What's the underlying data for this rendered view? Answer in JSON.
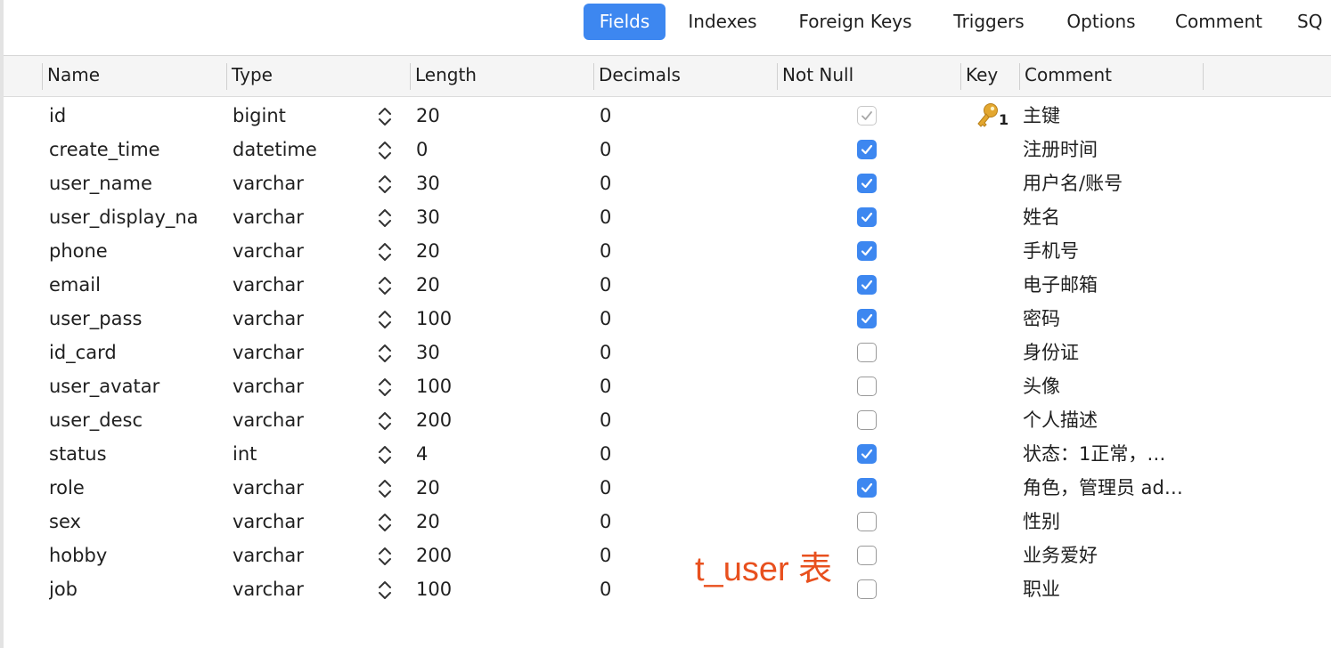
{
  "tabs": [
    {
      "label": "Fields",
      "active": true
    },
    {
      "label": "Indexes",
      "active": false
    },
    {
      "label": "Foreign Keys",
      "active": false
    },
    {
      "label": "Triggers",
      "active": false
    },
    {
      "label": "Options",
      "active": false
    },
    {
      "label": "Comment",
      "active": false
    },
    {
      "label": "SQ",
      "active": false
    }
  ],
  "columns": [
    "Name",
    "Type",
    "Length",
    "Decimals",
    "Not Null",
    "Key",
    "Comment"
  ],
  "rows": [
    {
      "name": "id",
      "type": "bigint",
      "length": "20",
      "decimals": "0",
      "not_null": true,
      "not_null_disabled": true,
      "key": "1",
      "comment": "主键"
    },
    {
      "name": "create_time",
      "type": "datetime",
      "length": "0",
      "decimals": "0",
      "not_null": true,
      "key": "",
      "comment": "注册时间"
    },
    {
      "name": "user_name",
      "type": "varchar",
      "length": "30",
      "decimals": "0",
      "not_null": true,
      "key": "",
      "comment": "用户名/账号"
    },
    {
      "name": "user_display_na",
      "type": "varchar",
      "length": "30",
      "decimals": "0",
      "not_null": true,
      "key": "",
      "comment": "姓名"
    },
    {
      "name": "phone",
      "type": "varchar",
      "length": "20",
      "decimals": "0",
      "not_null": true,
      "key": "",
      "comment": "手机号"
    },
    {
      "name": "email",
      "type": "varchar",
      "length": "20",
      "decimals": "0",
      "not_null": true,
      "key": "",
      "comment": "电子邮箱"
    },
    {
      "name": "user_pass",
      "type": "varchar",
      "length": "100",
      "decimals": "0",
      "not_null": true,
      "key": "",
      "comment": "密码"
    },
    {
      "name": "id_card",
      "type": "varchar",
      "length": "30",
      "decimals": "0",
      "not_null": false,
      "key": "",
      "comment": "身份证"
    },
    {
      "name": "user_avatar",
      "type": "varchar",
      "length": "100",
      "decimals": "0",
      "not_null": false,
      "key": "",
      "comment": "头像"
    },
    {
      "name": "user_desc",
      "type": "varchar",
      "length": "200",
      "decimals": "0",
      "not_null": false,
      "key": "",
      "comment": "个人描述"
    },
    {
      "name": "status",
      "type": "int",
      "length": "4",
      "decimals": "0",
      "not_null": true,
      "key": "",
      "comment": "状态：1正常，…"
    },
    {
      "name": "role",
      "type": "varchar",
      "length": "20",
      "decimals": "0",
      "not_null": true,
      "key": "",
      "comment": "角色，管理员 ad…"
    },
    {
      "name": "sex",
      "type": "varchar",
      "length": "20",
      "decimals": "0",
      "not_null": false,
      "key": "",
      "comment": "性别"
    },
    {
      "name": "hobby",
      "type": "varchar",
      "length": "200",
      "decimals": "0",
      "not_null": false,
      "key": "",
      "comment": "业务爱好"
    },
    {
      "name": "job",
      "type": "varchar",
      "length": "100",
      "decimals": "0",
      "not_null": false,
      "key": "",
      "comment": "职业"
    }
  ],
  "overlay_label": "t_user 表",
  "colors": {
    "accent": "#3d87f0",
    "overlay": "#e8501e",
    "key_icon": "#e3a72f"
  }
}
